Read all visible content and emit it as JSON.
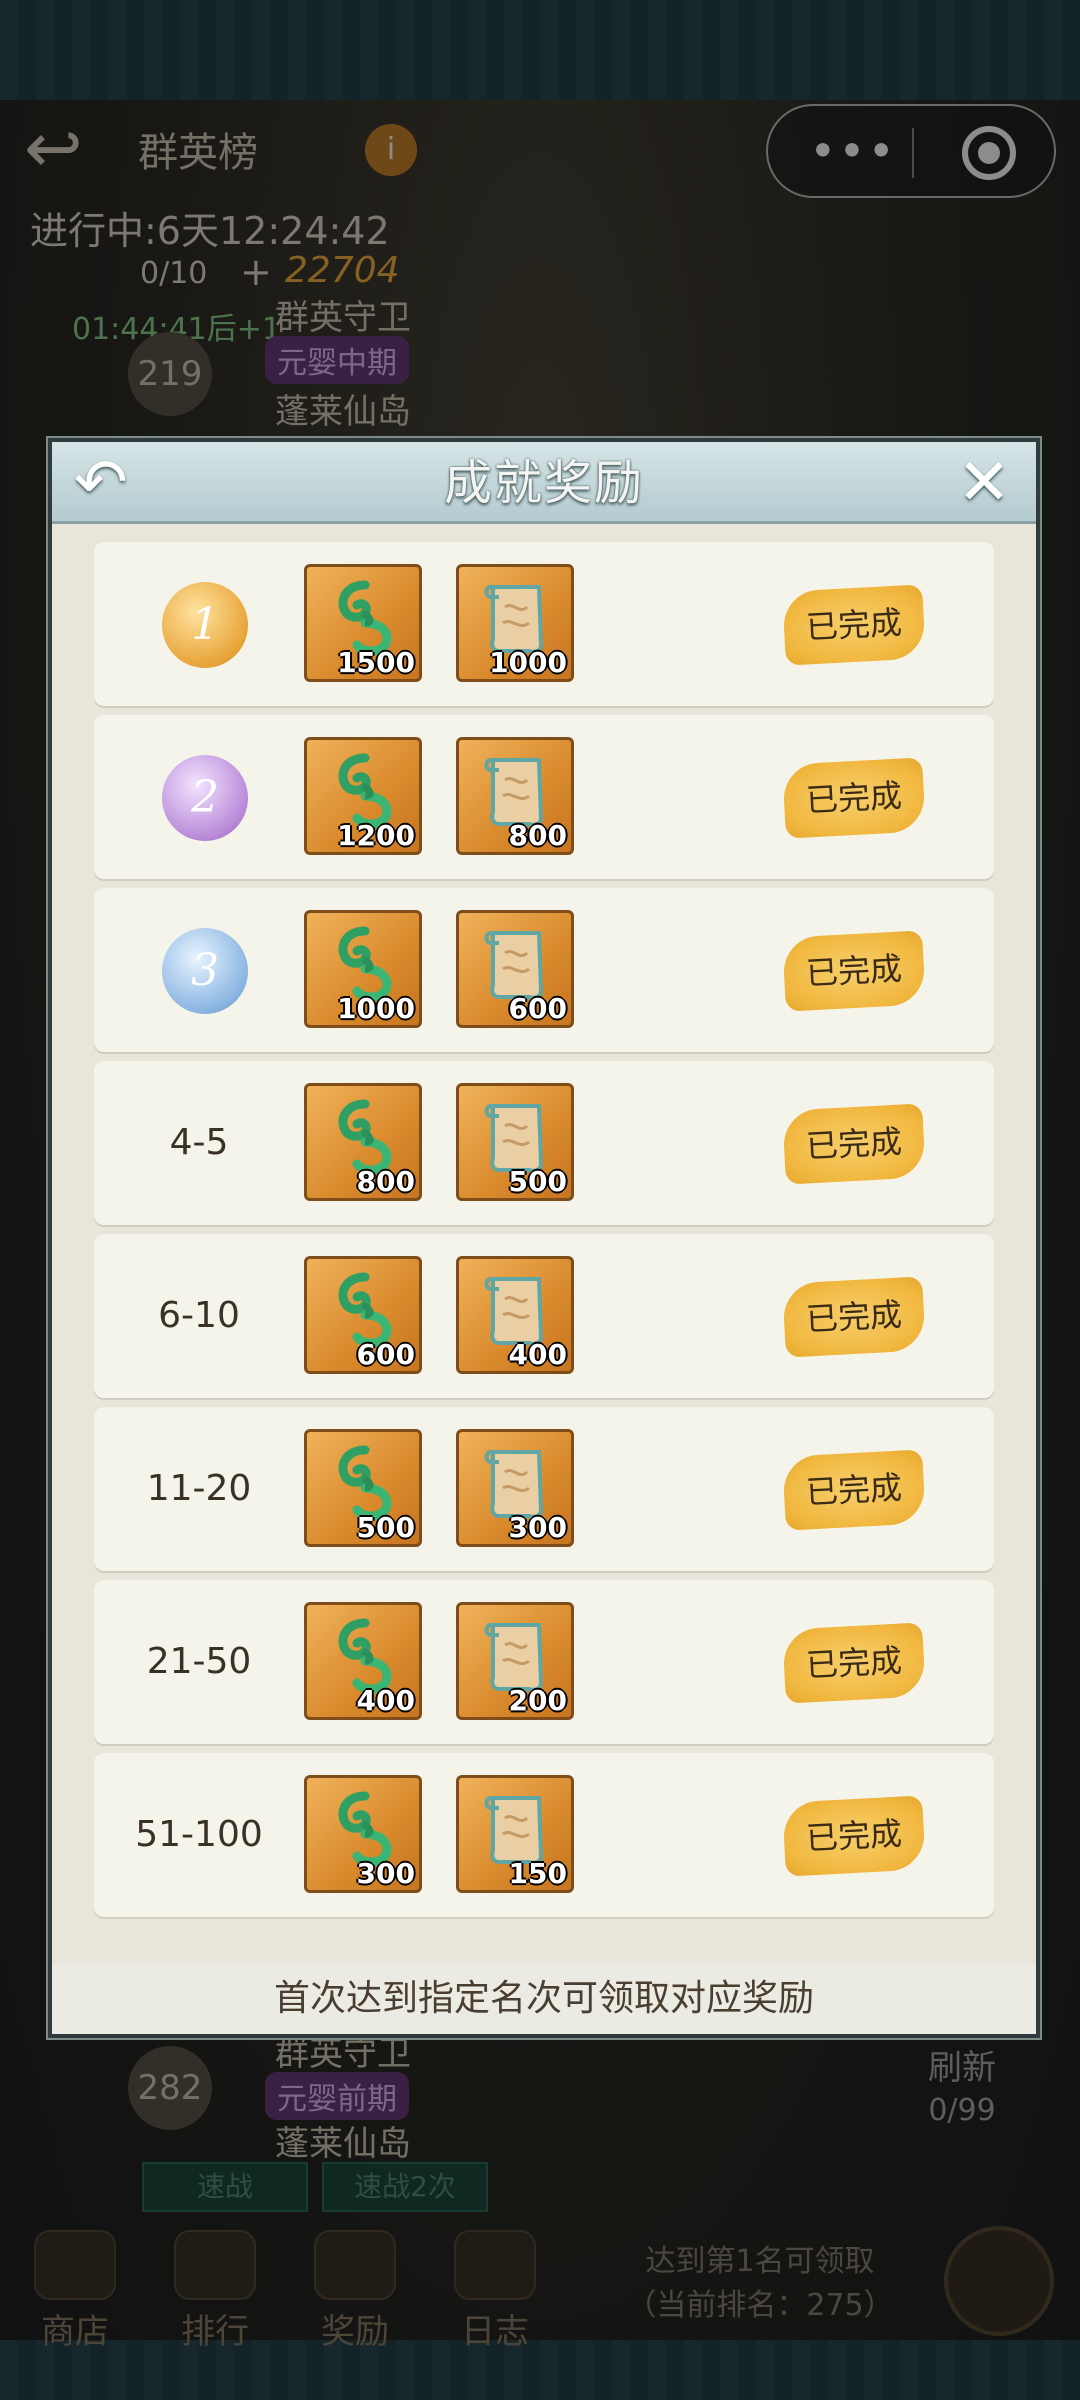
{
  "background": {
    "title": "群英榜",
    "progress": "进行中:6天12:24:42",
    "count": "0/10",
    "plus": "+",
    "score": "22704",
    "timer": "01:44:41后+1",
    "rank_top": "219",
    "name_top": "群英守卫",
    "tag_top": "元婴中期",
    "realm_top": "蓬莱仙岛",
    "rank_bottom": "282",
    "name_bottom": "群英守卫",
    "tag_bottom": "元婴前期",
    "realm_bottom": "蓬莱仙岛",
    "btn_fight": "速战",
    "btn_fight2": "速战2次",
    "refresh_label": "刷新",
    "refresh_count": "0/99",
    "nav": [
      "商店",
      "排行",
      "奖励",
      "日志"
    ],
    "reach_line1": "达到第1名可领取",
    "reach_line2": "（当前排名：275）",
    "info_icon": "i"
  },
  "capsule": {
    "more_icon": "•••"
  },
  "dialog": {
    "title": "成就奖励",
    "back_icon": "↶",
    "close_icon": "✕",
    "rows": [
      {
        "rank": "1",
        "medal": "gold",
        "jade": "1500",
        "scroll": "1000",
        "status": "已完成"
      },
      {
        "rank": "2",
        "medal": "purple",
        "jade": "1200",
        "scroll": "800",
        "status": "已完成"
      },
      {
        "rank": "3",
        "medal": "blue",
        "jade": "1000",
        "scroll": "600",
        "status": "已完成"
      },
      {
        "rank": "4-5",
        "medal": "",
        "jade": "800",
        "scroll": "500",
        "status": "已完成"
      },
      {
        "rank": "6-10",
        "medal": "",
        "jade": "600",
        "scroll": "400",
        "status": "已完成"
      },
      {
        "rank": "11-20",
        "medal": "",
        "jade": "500",
        "scroll": "300",
        "status": "已完成"
      },
      {
        "rank": "21-50",
        "medal": "",
        "jade": "400",
        "scroll": "200",
        "status": "已完成"
      },
      {
        "rank": "51-100",
        "medal": "",
        "jade": "300",
        "scroll": "150",
        "status": "已完成"
      }
    ],
    "footer": "首次达到指定名次可领取对应奖励"
  },
  "colors": {
    "accent": "#f1b840",
    "panel": "#f5f4ea",
    "header": "#b4cbd0"
  }
}
